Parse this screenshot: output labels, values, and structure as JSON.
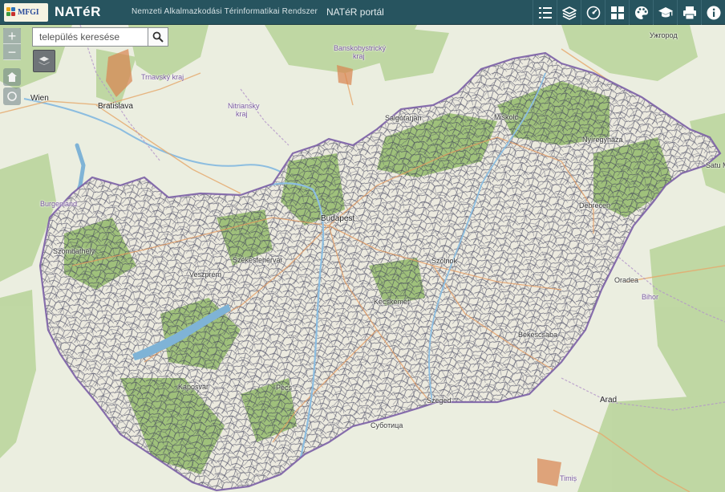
{
  "header": {
    "logo_text": "MFGI",
    "app_name": "NATéR",
    "subtitle": "Nemzeti Alkalmazkodási Térinformatikai Rendszer",
    "portal_link": "NATéR portál"
  },
  "toolbar": {
    "tools": [
      {
        "icon": "legend-list-icon"
      },
      {
        "icon": "layers-icon"
      },
      {
        "icon": "dashboard-icon"
      },
      {
        "icon": "grid-view-icon"
      },
      {
        "icon": "palette-icon"
      },
      {
        "icon": "graduation-cap-icon"
      },
      {
        "icon": "print-icon"
      },
      {
        "icon": "info-icon"
      }
    ]
  },
  "map_controls": {
    "zoom_in": "+",
    "zoom_out": "−",
    "search_placeholder": "település keresése"
  },
  "map_labels": {
    "wien": "Wien",
    "bratislava": "Bratislava",
    "burgenland": "Burgenland",
    "banskobystricky": "Banskobystrický",
    "kraj1": "kraj",
    "trnavsky": "Trnavský kraj",
    "nitriansky": "Nitriansky",
    "kraj2": "kraj",
    "uzhorod": "Ужгород",
    "miskolc": "Miskolc",
    "salgotarjan": "Salgótarján",
    "nyiregyhaza": "Nyíregyháza",
    "debrecen": "Debrecen",
    "oradea": "Oradea",
    "bihor": "Bihor",
    "arad": "Arad",
    "timis": "Timiș",
    "subotica": "Суботица",
    "szeged": "Szeged",
    "kecskemet": "Kecskemét",
    "szolnok": "Szolnok",
    "bekescsaba": "Békéscsaba",
    "budapest": "Budapest",
    "szekesfehervar": "Székesfehérvár",
    "veszprem": "Veszprém",
    "szombathely": "Szombathely",
    "pecs": "Pécs",
    "kaposvar": "Kaposvár",
    "satu_mare": "Satu M"
  },
  "colors": {
    "header_bg": "#27545f",
    "border_purple": "#7b5fa6",
    "settlement_lines": "#3b3c57",
    "forest_green": "#86b35a",
    "water_blue": "#7fb3d6"
  }
}
